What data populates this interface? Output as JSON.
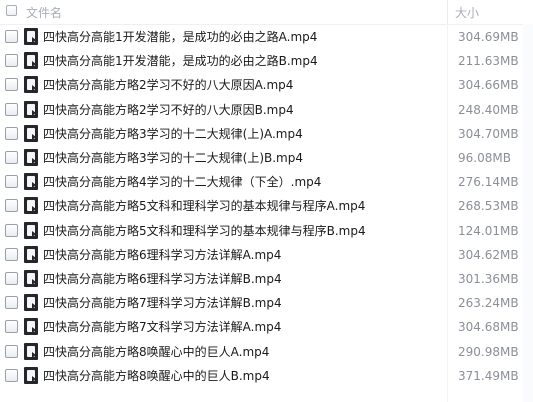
{
  "header": {
    "name_label": "文件名",
    "size_label": "大小"
  },
  "files": [
    {
      "name": "四快高分高能1开发潜能，是成功的必由之路A.mp4",
      "size": "304.69MB"
    },
    {
      "name": "四快高分高能1开发潜能，是成功的必由之路B.mp4",
      "size": "211.63MB"
    },
    {
      "name": "四快高分高能方略2学习不好的八大原因A.mp4",
      "size": "304.66MB"
    },
    {
      "name": "四快高分高能方略2学习不好的八大原因B.mp4",
      "size": "248.40MB"
    },
    {
      "name": "四快高分高能方略3学习的十二大规律(上)A.mp4",
      "size": "304.70MB"
    },
    {
      "name": "四快高分高能方略3学习的十二大规律(上)B.mp4",
      "size": "96.08MB"
    },
    {
      "name": "四快高分高能方略4学习的十二大规律（下全）.mp4",
      "size": "276.14MB"
    },
    {
      "name": "四快高分高能方略5文科和理科学习的基本规律与程序A.mp4",
      "size": "268.53MB"
    },
    {
      "name": "四快高分高能方略5文科和理科学习的基本规律与程序B.mp4",
      "size": "124.01MB"
    },
    {
      "name": "四快高分高能方略6理科学习方法详解A.mp4",
      "size": "304.62MB"
    },
    {
      "name": "四快高分高能方略6理科学习方法详解B.mp4",
      "size": "301.36MB"
    },
    {
      "name": "四快高分高能方略7理科学习方法详解B.mp4",
      "size": "263.24MB"
    },
    {
      "name": "四快高分高能方略7文科学习方法详解A.mp4",
      "size": "304.68MB"
    },
    {
      "name": "四快高分高能方略8唤醒心中的巨人A.mp4",
      "size": "290.98MB"
    },
    {
      "name": "四快高分高能方略8唤醒心中的巨人B.mp4",
      "size": "371.49MB"
    }
  ],
  "icons": {
    "row_icon": "video-file-icon",
    "checkbox": "checkbox-unchecked"
  },
  "colors": {
    "header_text": "#a8adb6",
    "name_text": "#1a1a1a",
    "size_text": "#8a8f98",
    "file_icon": "#24262b"
  }
}
